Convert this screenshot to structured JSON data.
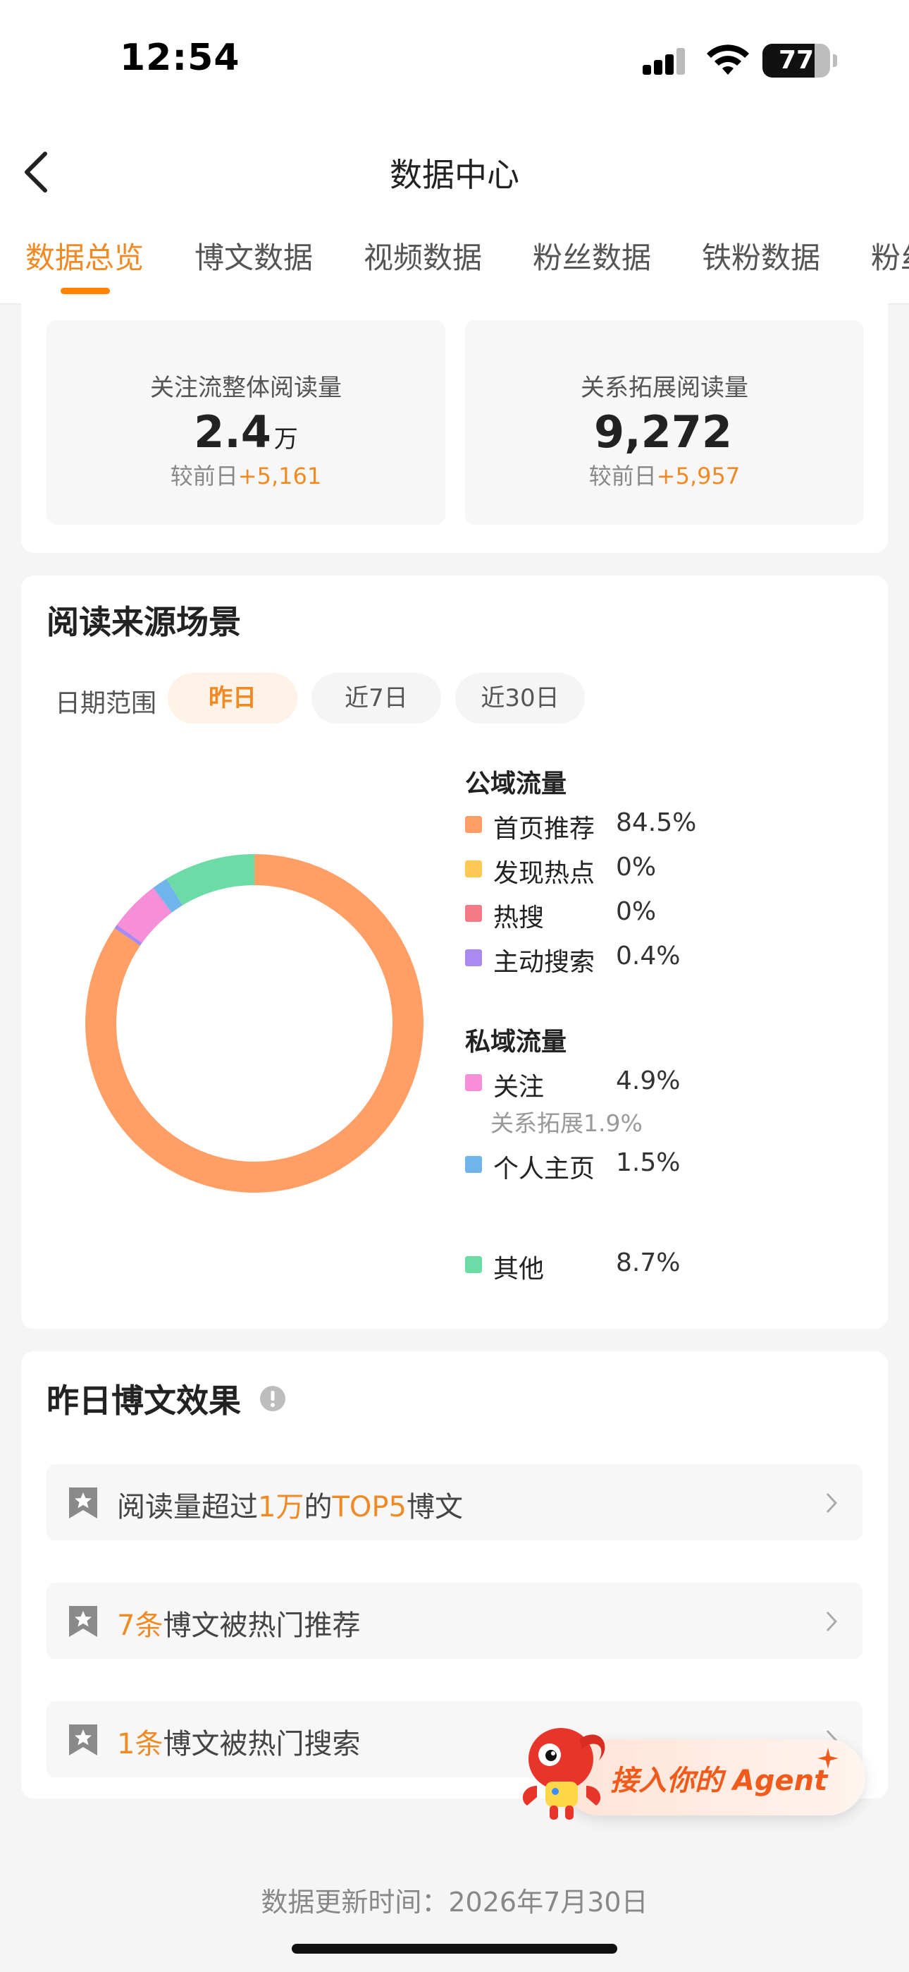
{
  "status_bar": {
    "time": "12:54",
    "battery": "77",
    "battery_level": 0.77
  },
  "header": {
    "title": "数据中心",
    "tabs": [
      "数据总览",
      "博文数据",
      "视频数据",
      "粉丝数据",
      "铁粉数据",
      "粉丝"
    ],
    "active_tab": 0
  },
  "overview": {
    "cards": [
      {
        "label": "关注流整体阅读量",
        "value": "2.4",
        "unit": "万",
        "delta_prefix": "较前日",
        "delta": "+5,161"
      },
      {
        "label": "关系拓展阅读量",
        "value": "9,272",
        "unit": "",
        "delta_prefix": "较前日",
        "delta": "+5,957"
      }
    ]
  },
  "sources": {
    "title": "阅读来源场景",
    "range_label": "日期范围",
    "ranges": [
      "昨日",
      "近7日",
      "近30日"
    ],
    "active_range": 0,
    "public_title": "公域流量",
    "private_title": "私域流量",
    "public": [
      {
        "name": "首页推荐",
        "pct": "84.5%",
        "color": "#ff9f66"
      },
      {
        "name": "发现热点",
        "pct": "0%",
        "color": "#ffc857"
      },
      {
        "name": "热搜",
        "pct": "0%",
        "color": "#f47b85"
      },
      {
        "name": "主动搜索",
        "pct": "0.4%",
        "color": "#a98af0"
      }
    ],
    "private": [
      {
        "name": "关注",
        "pct": "4.9%",
        "color": "#f78fd8",
        "sub": "关系拓展1.9%"
      },
      {
        "name": "个人主页",
        "pct": "1.5%",
        "color": "#6fb4ea"
      }
    ],
    "other": {
      "name": "其他",
      "pct": "8.7%",
      "color": "#6ddba6"
    }
  },
  "chart_data": {
    "type": "pie",
    "categories": [
      "首页推荐",
      "发现热点",
      "热搜",
      "主动搜索",
      "关注",
      "个人主页",
      "其他"
    ],
    "values": [
      84.5,
      0,
      0,
      0.4,
      4.9,
      1.5,
      8.7
    ],
    "colors": [
      "#ff9f66",
      "#ffc857",
      "#f47b85",
      "#a98af0",
      "#f78fd8",
      "#6fb4ea",
      "#6ddba6"
    ]
  },
  "effects": {
    "title": "昨日博文效果",
    "rows": [
      {
        "parts": [
          "阅读量超过",
          "1万",
          "的",
          "TOP5",
          "博文"
        ]
      },
      {
        "parts": [
          "7条",
          "博文被热门推荐"
        ]
      },
      {
        "parts": [
          "1条",
          "博文被热门搜索"
        ]
      }
    ]
  },
  "agent": {
    "label": "接入你的 Agent"
  },
  "footer": {
    "update_time": "数据更新时间：2026年7月30日"
  }
}
